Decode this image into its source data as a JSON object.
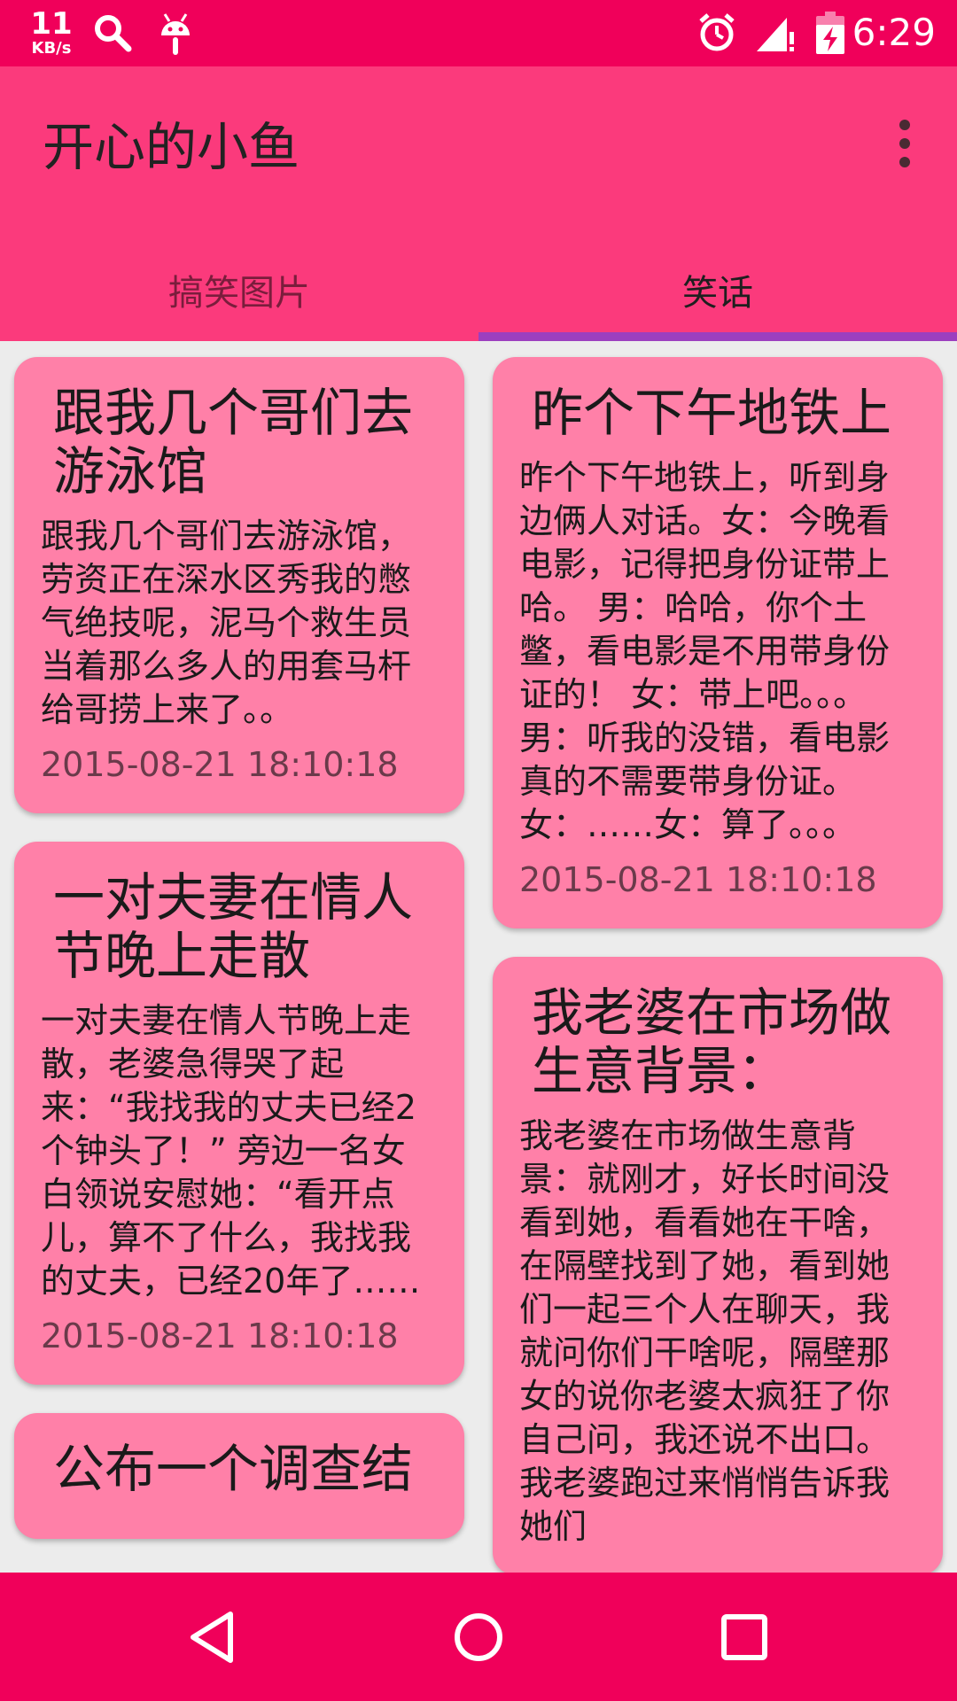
{
  "status_bar": {
    "speed_value": "11",
    "speed_unit": "KB/s",
    "time": "6:29",
    "icons": [
      "search-icon",
      "android-debug-icon",
      "alarm-icon",
      "signal-icon",
      "battery-charging-icon"
    ]
  },
  "app_bar": {
    "title": "开心的小鱼",
    "menu_icon": "more-vert-icon"
  },
  "tabs": [
    {
      "label": "搞笑图片",
      "selected": false
    },
    {
      "label": "笑话",
      "selected": true
    }
  ],
  "colors": {
    "status_bar": "#f0005a",
    "app_bar": "#fb3a7c",
    "card": "#ff80a8",
    "tab_indicator": "#9c3fbf",
    "nav_bar": "#f0005a"
  },
  "cards": {
    "left": [
      {
        "title": "跟我几个哥们去游泳馆",
        "body": "跟我几个哥们去游泳馆，劳资正在深水区秀我的憋气绝技呢，泥马个救生员当着那么多人的用套马杆给哥捞上来了。。",
        "date": "2015-08-21 18:10:18"
      },
      {
        "title": "一对夫妻在情人节晚上走散",
        "body": "一对夫妻在情人节晚上走散，老婆急得哭了起来：“我找我的丈夫已经2个钟头了！” 旁边一名女白领说安慰她：“看开点儿，算不了什么，我找我的丈夫，已经20年了……",
        "date": "2015-08-21 18:10:18"
      },
      {
        "title": "公布一个调查结",
        "body": "",
        "date": ""
      }
    ],
    "right": [
      {
        "title": "昨个下午地铁上",
        "body": "昨个下午地铁上，听到身边俩人对话。女：今晚看电影，记得把身份证带上哈。 男：哈哈，你个土鳖，看电影是不用带身份证的！ 女：带上吧。。。 男：听我的没错，看电影真的不需要带身份证。 女：……女：算了。。。",
        "date": "2015-08-21 18:10:18"
      },
      {
        "title": "我老婆在市场做生意背景：",
        "body": "我老婆在市场做生意背景：就刚才，好长时间没看到她，看看她在干啥，在隔壁找到了她，看到她们一起三个人在聊天，我就问你们干啥呢，隔壁那女的说你老婆太疯狂了你自己问，我还说不出口。我老婆跑过来悄悄告诉我她们",
        "date": ""
      }
    ]
  },
  "nav_bar": {
    "back": "back-icon",
    "home": "home-icon",
    "recents": "recents-icon"
  }
}
